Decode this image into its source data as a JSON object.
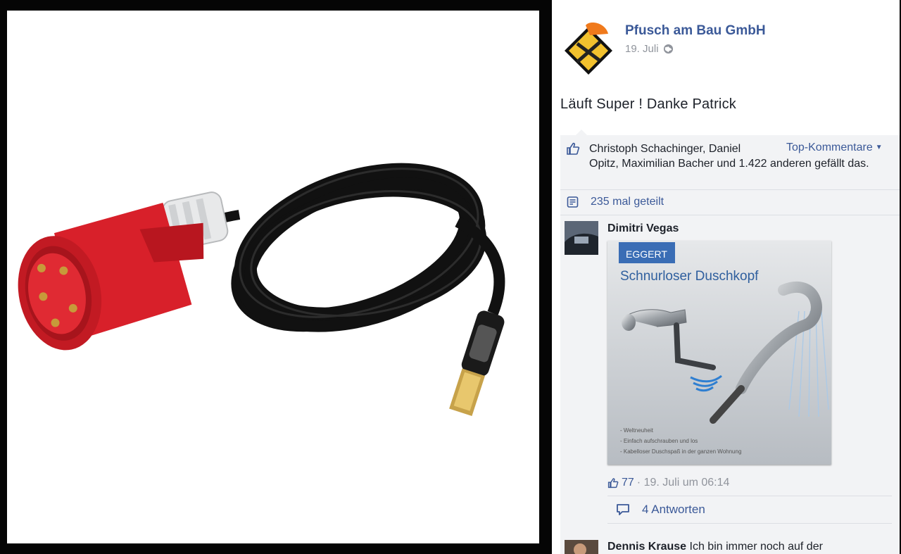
{
  "post": {
    "page_name": "Pfusch am Bau GmbH",
    "date": "19. Juli",
    "text": "Läuft Super ! Danke Patrick"
  },
  "ufi": {
    "likes_text_first": "Christoph Schachinger, Daniel",
    "likes_text_rest": "Opitz, Maximilian Bacher und 1.422 anderen gefällt das.",
    "top_comments": "Top-Kommentare",
    "shares": "235 mal geteilt"
  },
  "comment": {
    "author": "Dimitri Vegas",
    "image": {
      "brand": "EGGERT",
      "title": "Schnurloser Duschkopf",
      "bullets": [
        "- Weltneuheit",
        "- Einfach aufschrauben und los",
        "- Kabelloser Duschspaß in der ganzen Wohnung"
      ]
    },
    "like_count": "77",
    "time": "· 19. Juli um 06:14",
    "replies": "4 Antworten"
  },
  "comment2": {
    "author": "Dennis Krause",
    "text": "Ich bin immer noch auf der"
  },
  "icons": {
    "page_avatar": "construction-helmet-sign-icon",
    "privacy": "globe-icon",
    "like": "thumbs-up-icon",
    "share": "share-icon",
    "reply": "speech-bubble-icon"
  },
  "colors": {
    "link": "#3b5998",
    "ufi_bg": "#f2f3f5",
    "text": "#1d2129",
    "meta": "#90949c",
    "plug_red": "#d8202a"
  }
}
